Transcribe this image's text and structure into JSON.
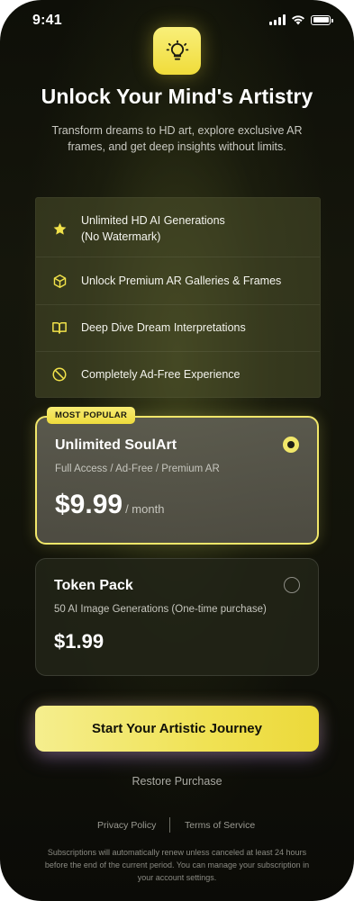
{
  "status_bar": {
    "time": "9:41"
  },
  "header": {
    "title": "Unlock Your Mind's Artistry",
    "subtitle": "Transform dreams to HD art, explore exclusive AR frames, and get deep insights without limits.",
    "icon": "lightbulb-icon"
  },
  "features": [
    {
      "icon": "star-icon",
      "line1": "Unlimited HD AI Generations",
      "line2": "(No Watermark)"
    },
    {
      "icon": "cube-icon",
      "line1": "Unlock Premium AR Galleries & Frames"
    },
    {
      "icon": "book-icon",
      "line1": "Deep Dive Dream Interpretations"
    },
    {
      "icon": "block-icon",
      "line1": "Completely Ad-Free Experience"
    }
  ],
  "plans": [
    {
      "badge": "MOST POPULAR",
      "name": "Unlimited SoulArt",
      "description": "Full Access / Ad-Free / Premium AR",
      "price": "$9.99",
      "period": "/ month",
      "selected": true
    },
    {
      "name": "Token Pack",
      "description": "50 AI Image Generations (One-time purchase)",
      "price": "$1.99",
      "selected": false
    }
  ],
  "cta": {
    "label": "Start Your Artistic Journey"
  },
  "restore": {
    "label": "Restore Purchase"
  },
  "footer": {
    "privacy": "Privacy Policy",
    "terms": "Terms of Service",
    "legal": "Subscriptions will automatically renew unless canceled at least 24 hours before the end of the current period. You can manage your subscription in your account settings."
  },
  "colors": {
    "accent": "#f1e76a",
    "background": "#12130a"
  }
}
